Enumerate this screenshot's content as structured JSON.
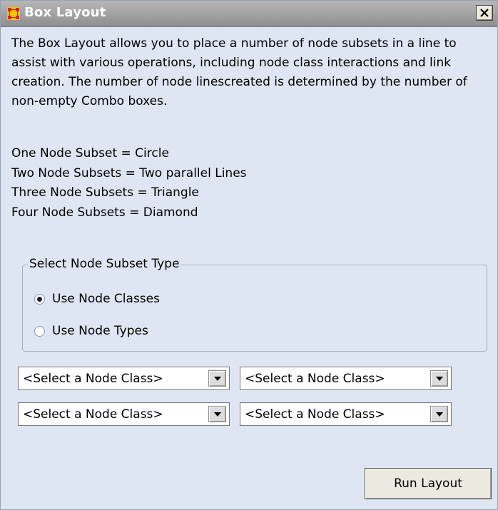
{
  "window": {
    "title": "Box Layout",
    "icon": "box-layout-icon",
    "close_icon": "close-icon"
  },
  "description": "The Box Layout allows you to place a number of node subsets in a line to assist with various operations, including node class interactions and link creation. The number of node linescreated is determined by the number of non-empty Combo boxes.",
  "subset_lines": [
    "One Node Subset = Circle",
    "Two Node Subsets = Two parallel Lines",
    "Three Node Subsets = Triangle",
    "Four Node Subsets = Diamond"
  ],
  "subset_type_group": {
    "label": "Select Node Subset Type",
    "options": [
      {
        "label": "Use Node Classes",
        "checked": true
      },
      {
        "label": "Use Node Types",
        "checked": false
      }
    ]
  },
  "combos": [
    {
      "value": "<Select a Node Class>"
    },
    {
      "value": "<Select a Node Class>"
    },
    {
      "value": "<Select a Node Class>"
    },
    {
      "value": "<Select a Node Class>"
    }
  ],
  "run_button": {
    "label": "Run Layout"
  },
  "colors": {
    "background": "#dde6f2",
    "titlebar": "#a0a0a0"
  }
}
